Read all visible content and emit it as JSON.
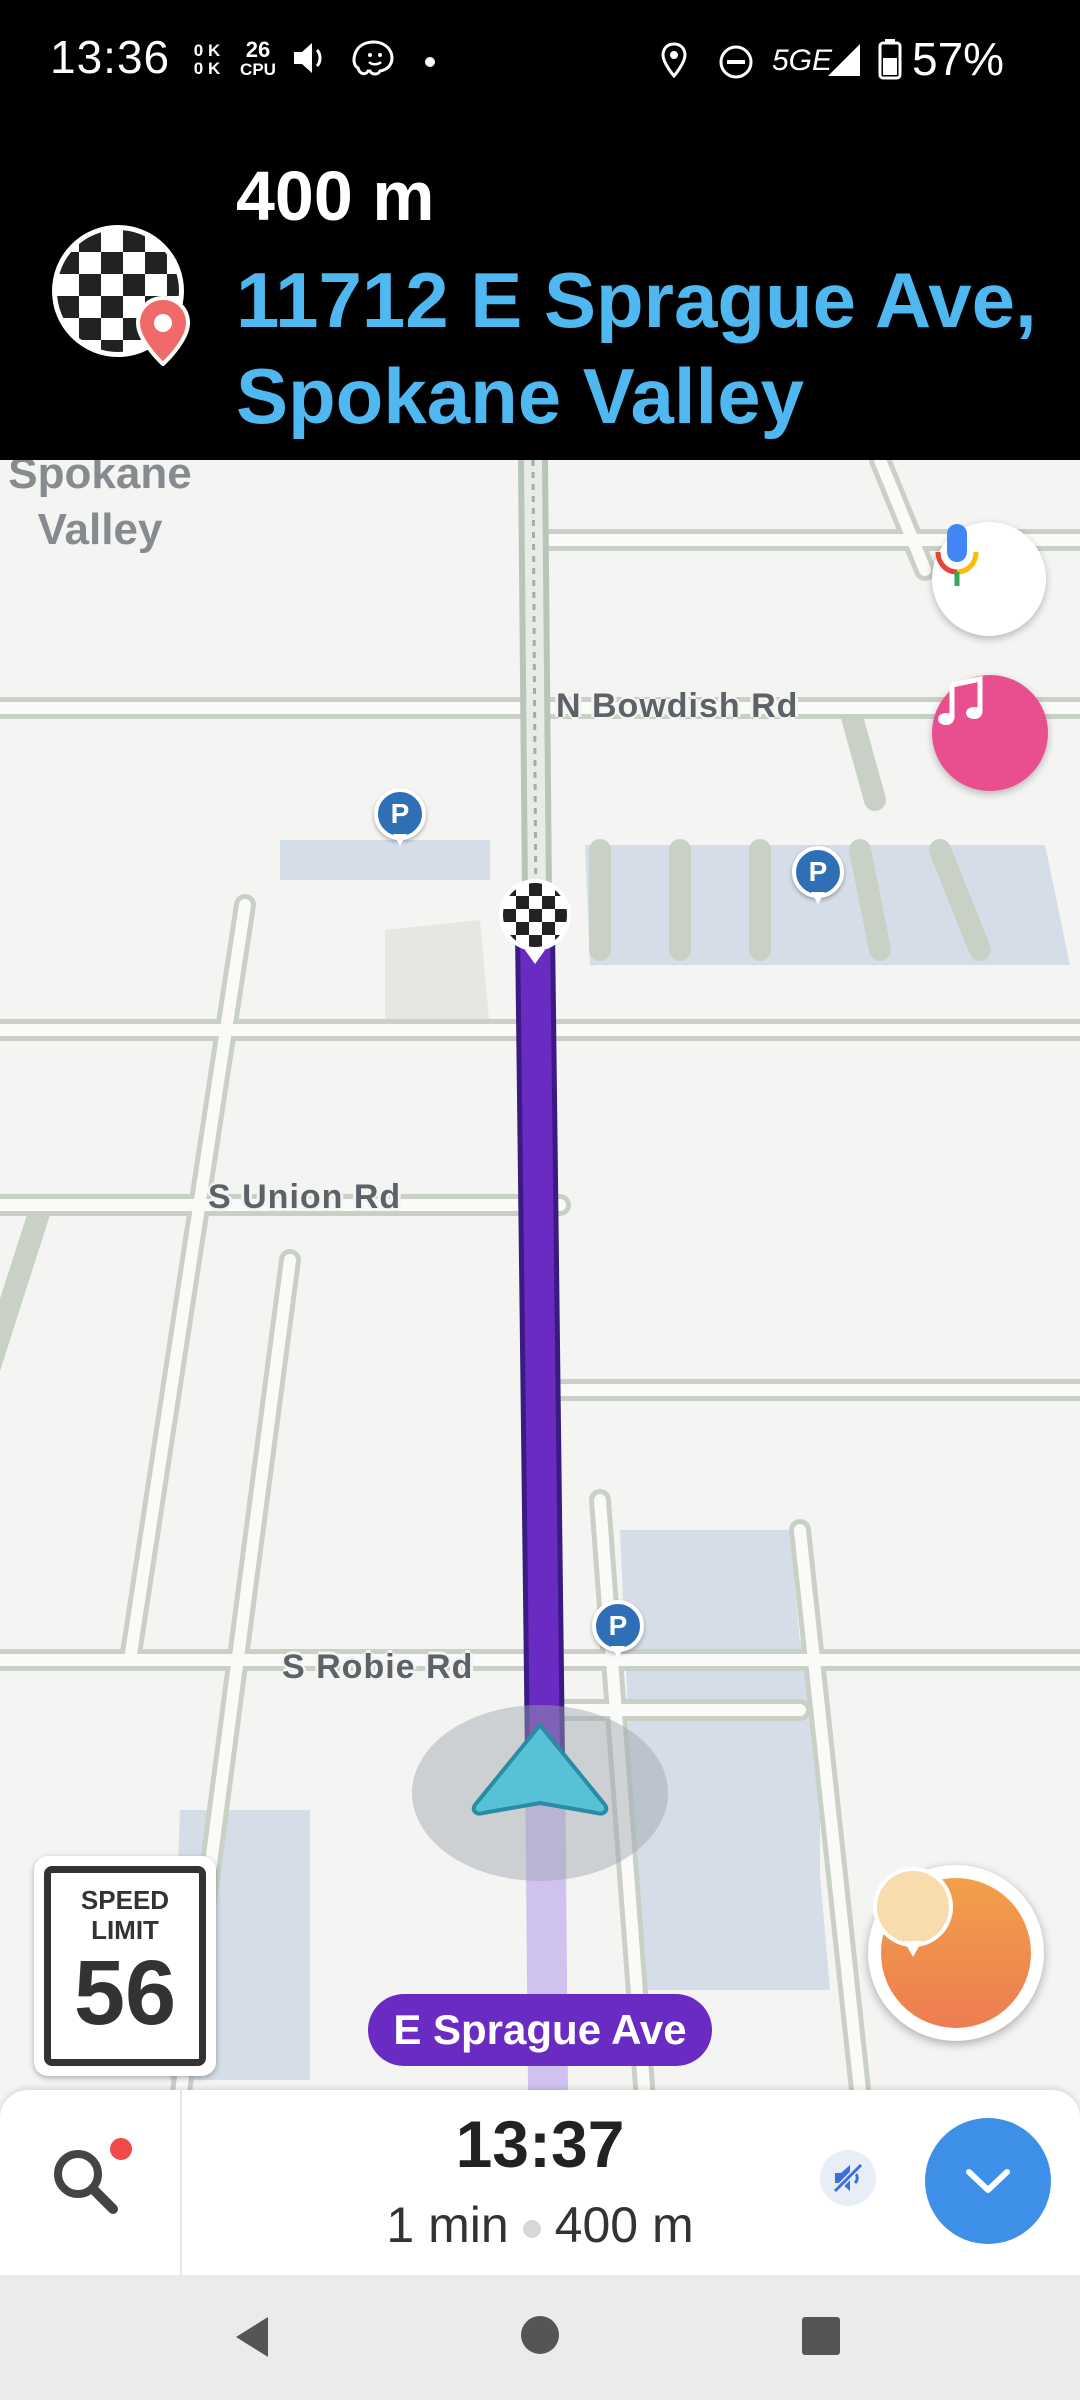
{
  "status_bar": {
    "time": "13:36",
    "net_up": "0 K",
    "net_down": "0 K",
    "cpu_value": "26",
    "cpu_label": "CPU",
    "network": "5GE",
    "battery": "57%"
  },
  "instruction": {
    "distance": "400 m",
    "street_line1": "11712 E Sprague Ave,",
    "street_line2": "Spokane Valley"
  },
  "map": {
    "city_line1": "Spokane",
    "city_line2": "Valley",
    "roads": {
      "bowdish": "N Bowdish Rd",
      "union": "S Union Rd",
      "robie": "S Robie Rd"
    },
    "parking_label": "P",
    "route_color": "#6a2bc2"
  },
  "speed_limit": {
    "label_line1": "SPEED",
    "label_line2": "LIMIT",
    "value": "56"
  },
  "current_street": "E Sprague Ave",
  "eta": {
    "arrival_time": "13:37",
    "duration": "1 min",
    "distance": "400 m"
  },
  "icons": {
    "mic": "microphone-icon",
    "music": "music-note-icon",
    "report": "report-icon",
    "search": "search-icon",
    "mute": "sound-off-icon",
    "expand": "chevron-down-icon"
  }
}
